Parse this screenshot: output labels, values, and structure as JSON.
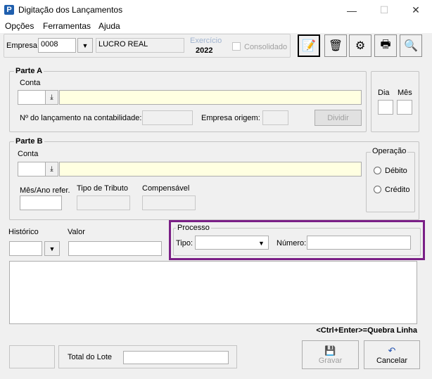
{
  "window": {
    "title": "Digitação dos Lançamentos",
    "minimize_glyph": "—",
    "maximize_glyph": "☐",
    "close_glyph": "✕"
  },
  "menu": {
    "items": [
      "Opções",
      "Ferramentas",
      "Ajuda"
    ]
  },
  "header": {
    "empresa_label": "Empresa:",
    "empresa_value": "0008",
    "empresa_name": "LUCRO REAL",
    "exercicio_label": "Exercício",
    "exercicio_value": "2022",
    "consolidado_label": "Consolidado"
  },
  "toolbar": {
    "icons": [
      "document-edit-icon",
      "recycle-bin-icon",
      "tools-icon",
      "printer-icon",
      "search-document-icon"
    ]
  },
  "parte_a": {
    "title": "Parte A",
    "conta_label": "Conta",
    "num_lancamento_label": "Nº do lançamento na contabilidade:",
    "empresa_origem_label": "Empresa origem:",
    "dividir_label": "Dividir",
    "dia_label": "Dia",
    "mes_label": "Mês"
  },
  "parte_b": {
    "title": "Parte B",
    "conta_label": "Conta",
    "mes_ano_label": "Mês/Ano refer.",
    "tipo_tributo_label": "Tipo de Tributo",
    "compensavel_label": "Compensável",
    "operacao_title": "Operação",
    "debito_label": "Débito",
    "credito_label": "Crédito"
  },
  "lower": {
    "historico_label": "Histórico",
    "valor_label": "Valor",
    "processo_title": "Processo",
    "tipo_label": "Tipo:",
    "numero_label": "Número:",
    "hint": "<Ctrl+Enter>=Quebra Linha",
    "total_lote_label": "Total do Lote",
    "gravar_label": "Gravar",
    "cancelar_label": "Cancelar"
  },
  "colors": {
    "highlight_border": "#7a1f86",
    "yellow_field": "#ffffe1"
  }
}
